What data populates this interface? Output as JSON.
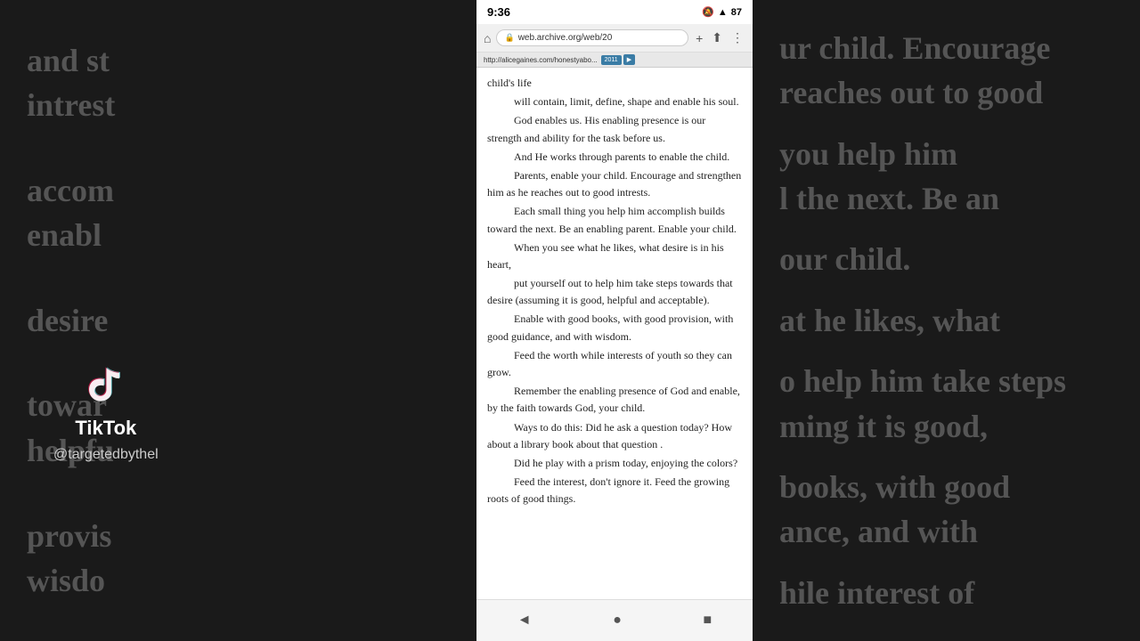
{
  "background": {
    "left_texts": [
      "and st",
      "intrest",
      "accom",
      "enabl",
      "desire",
      "towar",
      "helpfu",
      "provis",
      "wisdo"
    ],
    "right_texts": [
      "ur child. Encourage",
      "reaches out to good",
      "you help him",
      "l the next. Be an",
      "our child.",
      "at he likes, what",
      "o help him take steps",
      "ming it is good,",
      "books, with good",
      "ance, and with",
      "hile interest of"
    ]
  },
  "tiktok": {
    "label": "TikTok",
    "username": "@targetedbythel"
  },
  "status_bar": {
    "time": "9:36",
    "signal": "87"
  },
  "browser": {
    "url": "web.archive.org/web/20",
    "lock_icon": "🔒"
  },
  "archive": {
    "placeholder": "http://alicegaines.com/honestyabo..."
  },
  "content": {
    "paragraphs": [
      "child's life",
      "will contain, limit, define, shape and enable his soul.",
      "God enables us. His enabling presence is our strength and ability for the task before us.",
      "And He works through parents to enable the child.",
      "Parents, enable your child. Encourage and strengthen him as he reaches out to good intrests.",
      "Each small thing you help him accomplish builds toward the next. Be an enabling parent. Enable your child.",
      "When you see what he likes, what desire is in his heart,",
      "put yourself out to help him take steps towards that desire (assuming it is good, helpful and acceptable).",
      "Enable with good books, with good provision, with good guidance, and with wisdom.",
      "Feed the worth while interests of youth so they can grow.",
      "Remember the enabling presence of God and enable, by the faith towards God, your child.",
      "Ways to do this: Did he ask a question today? How about a library book about that question .",
      "Did he play with a prism today, enjoying the colors?",
      "Feed the interest, don't ignore it. Feed the growing roots of good things."
    ]
  },
  "nav": {
    "back": "◄",
    "home": "●",
    "square": "■"
  }
}
